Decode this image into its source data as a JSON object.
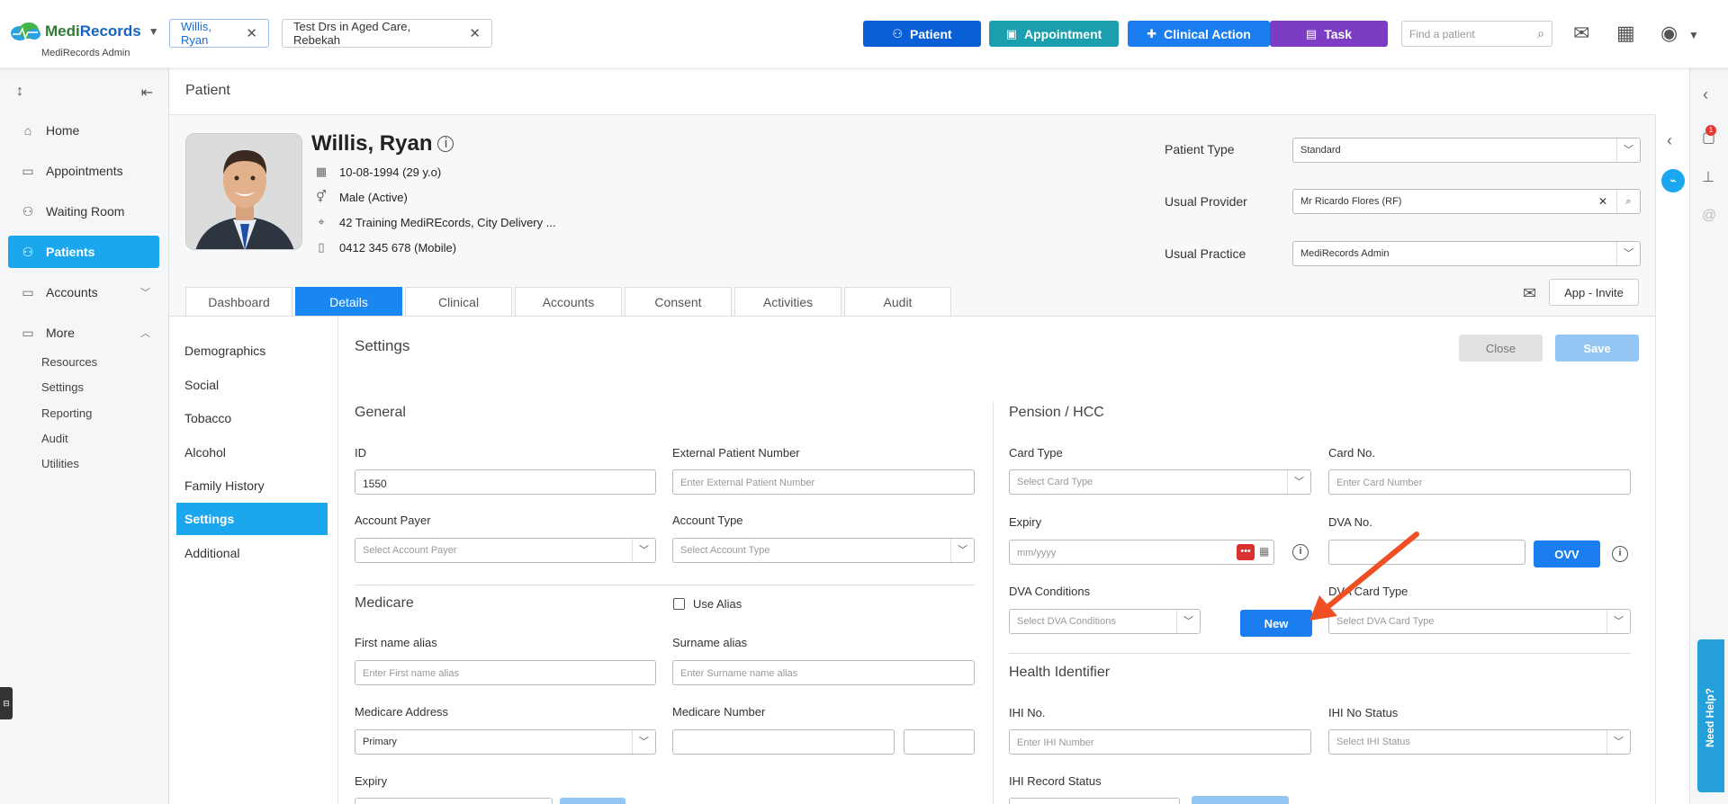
{
  "app": {
    "brand_medi": "Medi",
    "brand_records": "Records",
    "subtitle": "MediRecords Admin"
  },
  "open_tabs": [
    {
      "label": "Willis, Ryan"
    },
    {
      "label": "Test Drs in Aged Care, Rebekah"
    }
  ],
  "toolbar": {
    "patient_label": "Patient",
    "appointment_label": "Appointment",
    "clinical_action_label": "Clinical Action",
    "task_label": "Task",
    "find_placeholder": "Find a patient"
  },
  "colors": {
    "patient_btn": "#0b5fd6",
    "appointment_btn": "#1b9fae",
    "clinical_btn": "#1a7ef0",
    "task_btn": "#7c3cc4",
    "active_nav": "#1aa7ee",
    "annotation_arrow": "#f04e23"
  },
  "sidebar": {
    "items": [
      {
        "label": "Home",
        "icon": "home-icon"
      },
      {
        "label": "Appointments",
        "icon": "calendar-icon"
      },
      {
        "label": "Waiting Room",
        "icon": "people-icon"
      },
      {
        "label": "Patients",
        "icon": "patient-icon"
      },
      {
        "label": "Accounts",
        "icon": "folder-icon"
      },
      {
        "label": "More",
        "icon": "folder-tree-icon"
      }
    ],
    "more_items": [
      {
        "label": "Resources"
      },
      {
        "label": "Settings"
      },
      {
        "label": "Reporting"
      },
      {
        "label": "Audit"
      },
      {
        "label": "Utilities"
      }
    ]
  },
  "page": {
    "title": "Patient"
  },
  "patient": {
    "name": "Willis, Ryan",
    "dob": "10-08-1994 (29 y.o)",
    "gender": "Male (Active)",
    "address": "42 Training MediREcords, City Delivery ...",
    "phone": "0412 345 678 (Mobile)",
    "type_label": "Patient Type",
    "type_value": "Standard",
    "provider_label": "Usual Provider",
    "provider_value": "Mr Ricardo Flores (RF)",
    "practice_label": "Usual Practice",
    "practice_value": "MediRecords Admin",
    "app_invite": "App - Invite"
  },
  "tabs": [
    {
      "label": "Dashboard"
    },
    {
      "label": "Details"
    },
    {
      "label": "Clinical"
    },
    {
      "label": "Accounts"
    },
    {
      "label": "Consent"
    },
    {
      "label": "Activities"
    },
    {
      "label": "Audit"
    }
  ],
  "subnav": [
    {
      "label": "Demographics"
    },
    {
      "label": "Social"
    },
    {
      "label": "Tobacco"
    },
    {
      "label": "Alcohol"
    },
    {
      "label": "Family History"
    },
    {
      "label": "Settings"
    },
    {
      "label": "Additional"
    }
  ],
  "settings": {
    "title": "Settings",
    "close": "Close",
    "save": "Save",
    "general": {
      "title": "General",
      "id_label": "ID",
      "id_value": "1550",
      "ext_label": "External Patient Number",
      "ext_placeholder": "Enter External Patient Number",
      "payer_label": "Account Payer",
      "payer_placeholder": "Select Account Payer",
      "acct_type_label": "Account Type",
      "acct_type_placeholder": "Select Account Type"
    },
    "medicare": {
      "title": "Medicare",
      "use_alias": "Use Alias",
      "first_alias_label": "First name alias",
      "first_alias_placeholder": "Enter First name alias",
      "surname_alias_label": "Surname alias",
      "surname_alias_placeholder": "Enter Surname name alias",
      "address_label": "Medicare Address",
      "address_value": "Primary",
      "number_label": "Medicare Number",
      "expiry_label": "Expiry"
    },
    "pension": {
      "title": "Pension / HCC",
      "card_type_label": "Card Type",
      "card_type_placeholder": "Select Card Type",
      "card_no_label": "Card No.",
      "card_no_placeholder": "Enter Card Number",
      "expiry_label": "Expiry",
      "expiry_placeholder": "mm/yyyy",
      "dva_no_label": "DVA No.",
      "ovv": "OVV",
      "dva_cond_label": "DVA Conditions",
      "dva_cond_placeholder": "Select DVA Conditions",
      "new": "New",
      "dva_card_label": "DVA Card Type",
      "dva_card_placeholder": "Select DVA Card Type"
    },
    "health": {
      "title": "Health Identifier",
      "ihi_label": "IHI No.",
      "ihi_placeholder": "Enter IHI Number",
      "ihi_status_label": "IHI No Status",
      "ihi_status_placeholder": "Select IHI Status",
      "ihi_record_label": "IHI Record Status"
    }
  },
  "help": {
    "label": "Need Help?"
  },
  "notifications": {
    "count": "1"
  }
}
